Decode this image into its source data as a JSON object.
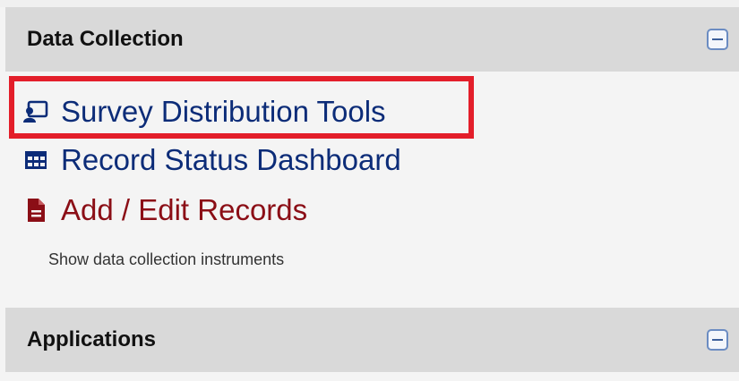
{
  "sections": [
    {
      "title": "Data Collection",
      "items": [
        {
          "label": "Survey Distribution Tools",
          "icon": "survey-distribution-icon",
          "color": "#0c2c78"
        },
        {
          "label": "Record Status Dashboard",
          "icon": "table-grid-icon",
          "color": "#0c2c78"
        },
        {
          "label": "Add / Edit Records",
          "icon": "document-icon",
          "color": "#8b0e16"
        }
      ],
      "hint": "Show data collection instruments"
    },
    {
      "title": "Applications"
    }
  ],
  "colors": {
    "header_bg": "#d9d9d9",
    "body_bg": "#f4f4f4",
    "highlight": "#e31e2a",
    "link_blue": "#0c2c78",
    "link_red": "#8b0e16"
  }
}
